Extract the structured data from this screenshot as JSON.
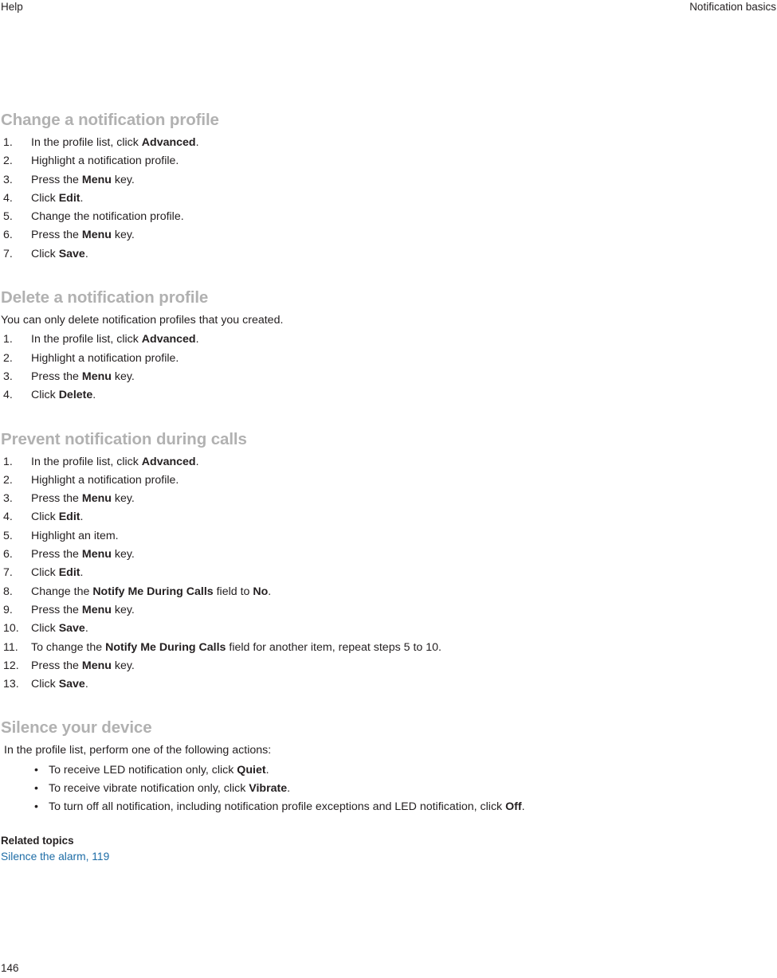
{
  "header": {
    "left": "Help",
    "right": "Notification basics"
  },
  "colors": {
    "heading": "#b1b1b1",
    "body": "#231f20",
    "link": "#1d6ca6",
    "background": "#ffffff"
  },
  "sections": [
    {
      "title": "Change a notification profile",
      "intro": null,
      "list_type": "ordered",
      "items": [
        [
          {
            "t": "In the profile list, click ",
            "b": false
          },
          {
            "t": "Advanced",
            "b": true
          },
          {
            "t": ".",
            "b": false
          }
        ],
        [
          {
            "t": "Highlight a notification profile.",
            "b": false
          }
        ],
        [
          {
            "t": "Press the ",
            "b": false
          },
          {
            "t": "Menu",
            "b": true
          },
          {
            "t": " key.",
            "b": false
          }
        ],
        [
          {
            "t": "Click ",
            "b": false
          },
          {
            "t": "Edit",
            "b": true
          },
          {
            "t": ".",
            "b": false
          }
        ],
        [
          {
            "t": "Change the notification profile.",
            "b": false
          }
        ],
        [
          {
            "t": "Press the ",
            "b": false
          },
          {
            "t": "Menu",
            "b": true
          },
          {
            "t": " key.",
            "b": false
          }
        ],
        [
          {
            "t": "Click ",
            "b": false
          },
          {
            "t": "Save",
            "b": true
          },
          {
            "t": ".",
            "b": false
          }
        ]
      ]
    },
    {
      "title": "Delete a notification profile",
      "intro": "You can only delete notification profiles that you created.",
      "list_type": "ordered",
      "items": [
        [
          {
            "t": "In the profile list, click ",
            "b": false
          },
          {
            "t": "Advanced",
            "b": true
          },
          {
            "t": ".",
            "b": false
          }
        ],
        [
          {
            "t": "Highlight a notification profile.",
            "b": false
          }
        ],
        [
          {
            "t": "Press the ",
            "b": false
          },
          {
            "t": "Menu",
            "b": true
          },
          {
            "t": " key.",
            "b": false
          }
        ],
        [
          {
            "t": "Click ",
            "b": false
          },
          {
            "t": "Delete",
            "b": true
          },
          {
            "t": ".",
            "b": false
          }
        ]
      ]
    },
    {
      "title": "Prevent notification during calls",
      "intro": null,
      "list_type": "ordered",
      "items": [
        [
          {
            "t": "In the profile list, click ",
            "b": false
          },
          {
            "t": "Advanced",
            "b": true
          },
          {
            "t": ".",
            "b": false
          }
        ],
        [
          {
            "t": "Highlight a notification profile.",
            "b": false
          }
        ],
        [
          {
            "t": "Press the ",
            "b": false
          },
          {
            "t": "Menu",
            "b": true
          },
          {
            "t": " key.",
            "b": false
          }
        ],
        [
          {
            "t": "Click ",
            "b": false
          },
          {
            "t": "Edit",
            "b": true
          },
          {
            "t": ".",
            "b": false
          }
        ],
        [
          {
            "t": "Highlight an item.",
            "b": false
          }
        ],
        [
          {
            "t": "Press the ",
            "b": false
          },
          {
            "t": "Menu",
            "b": true
          },
          {
            "t": " key.",
            "b": false
          }
        ],
        [
          {
            "t": "Click ",
            "b": false
          },
          {
            "t": "Edit",
            "b": true
          },
          {
            "t": ".",
            "b": false
          }
        ],
        [
          {
            "t": "Change the ",
            "b": false
          },
          {
            "t": "Notify Me During Calls",
            "b": true
          },
          {
            "t": " field to ",
            "b": false
          },
          {
            "t": "No",
            "b": true
          },
          {
            "t": ".",
            "b": false
          }
        ],
        [
          {
            "t": "Press the ",
            "b": false
          },
          {
            "t": "Menu",
            "b": true
          },
          {
            "t": " key.",
            "b": false
          }
        ],
        [
          {
            "t": "Click ",
            "b": false
          },
          {
            "t": "Save",
            "b": true
          },
          {
            "t": ".",
            "b": false
          }
        ],
        [
          {
            "t": "To change the ",
            "b": false
          },
          {
            "t": "Notify Me During Calls",
            "b": true
          },
          {
            "t": " field for another item, repeat steps 5 to 10.",
            "b": false
          }
        ],
        [
          {
            "t": "Press the ",
            "b": false
          },
          {
            "t": "Menu",
            "b": true
          },
          {
            "t": " key.",
            "b": false
          }
        ],
        [
          {
            "t": "Click ",
            "b": false
          },
          {
            "t": "Save",
            "b": true
          },
          {
            "t": ".",
            "b": false
          }
        ]
      ]
    },
    {
      "title": "Silence your device",
      "intro": "In the profile list, perform one of the following actions:",
      "intro_indented": true,
      "list_type": "unordered",
      "bullet_glyph": "•",
      "items": [
        [
          {
            "t": "To receive LED notification only, click ",
            "b": false
          },
          {
            "t": "Quiet",
            "b": true
          },
          {
            "t": ".",
            "b": false
          }
        ],
        [
          {
            "t": "To receive vibrate notification only, click ",
            "b": false
          },
          {
            "t": "Vibrate",
            "b": true
          },
          {
            "t": ".",
            "b": false
          }
        ],
        [
          {
            "t": "To turn off all notification, including notification profile exceptions and LED notification, click ",
            "b": false
          },
          {
            "t": "Off",
            "b": true
          },
          {
            "t": ".",
            "b": false
          }
        ]
      ]
    }
  ],
  "related": {
    "heading": "Related topics",
    "links": [
      "Silence the alarm, 119"
    ]
  },
  "footer": {
    "page_number": "146"
  }
}
